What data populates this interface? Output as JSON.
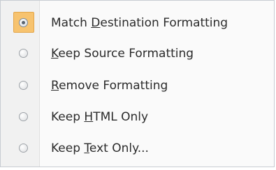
{
  "menu": {
    "options": [
      {
        "pre": "Match ",
        "key": "D",
        "post": "estination Formatting",
        "selected": true
      },
      {
        "pre": "",
        "key": "K",
        "post": "eep Source Formatting",
        "selected": false
      },
      {
        "pre": "",
        "key": "R",
        "post": "emove Formatting",
        "selected": false
      },
      {
        "pre": "Keep ",
        "key": "H",
        "post": "TML Only",
        "selected": false
      },
      {
        "pre": "Keep ",
        "key": "T",
        "post": "ext Only...",
        "selected": false
      }
    ]
  }
}
